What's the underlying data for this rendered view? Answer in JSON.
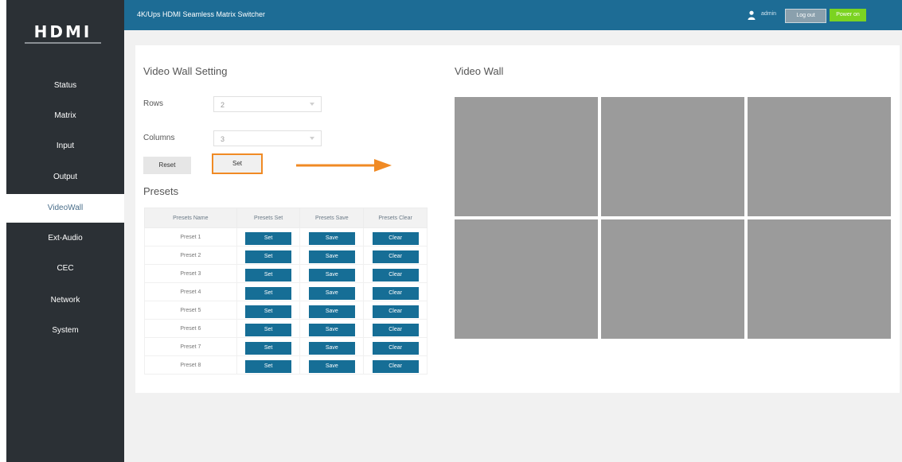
{
  "logo": {
    "text": "HDMI"
  },
  "sidebar": {
    "items": [
      {
        "label": "Status"
      },
      {
        "label": "Matrix"
      },
      {
        "label": "Input"
      },
      {
        "label": "Output"
      },
      {
        "label": "VideoWall"
      },
      {
        "label": "Ext-Audio"
      },
      {
        "label": "CEC"
      },
      {
        "label": "Network"
      },
      {
        "label": "System"
      }
    ],
    "active_item": "VideoWall"
  },
  "header": {
    "title": "4K/Ups HDMI Seamless Matrix Switcher",
    "user": "admin",
    "logout_label": "Log out",
    "power_label": "Power on"
  },
  "settings": {
    "title": "Video Wall Setting",
    "rows_label": "Rows",
    "rows_value": "2",
    "columns_label": "Columns",
    "columns_value": "3",
    "reset_label": "Reset",
    "set_label": "Set"
  },
  "presets": {
    "title": "Presets",
    "columns": [
      "Presets Name",
      "Presets Set",
      "Presets Save",
      "Presets Clear"
    ],
    "rows": [
      {
        "name": "Preset 1",
        "set": "Set",
        "save": "Save",
        "clear": "Clear"
      },
      {
        "name": "Preset 2",
        "set": "Set",
        "save": "Save",
        "clear": "Clear"
      },
      {
        "name": "Preset 3",
        "set": "Set",
        "save": "Save",
        "clear": "Clear"
      },
      {
        "name": "Preset 4",
        "set": "Set",
        "save": "Save",
        "clear": "Clear"
      },
      {
        "name": "Preset 5",
        "set": "Set",
        "save": "Save",
        "clear": "Clear"
      },
      {
        "name": "Preset 6",
        "set": "Set",
        "save": "Save",
        "clear": "Clear"
      },
      {
        "name": "Preset 7",
        "set": "Set",
        "save": "Save",
        "clear": "Clear"
      },
      {
        "name": "Preset 8",
        "set": "Set",
        "save": "Save",
        "clear": "Clear"
      }
    ]
  },
  "video_wall": {
    "title": "Video Wall",
    "rows": 2,
    "columns": 3
  },
  "colors": {
    "sidebar": "#2b3035",
    "header": "#1d6c95",
    "table_button": "#166e96",
    "highlight": "#f08a24",
    "wall_cell": "#9b9b9b"
  }
}
